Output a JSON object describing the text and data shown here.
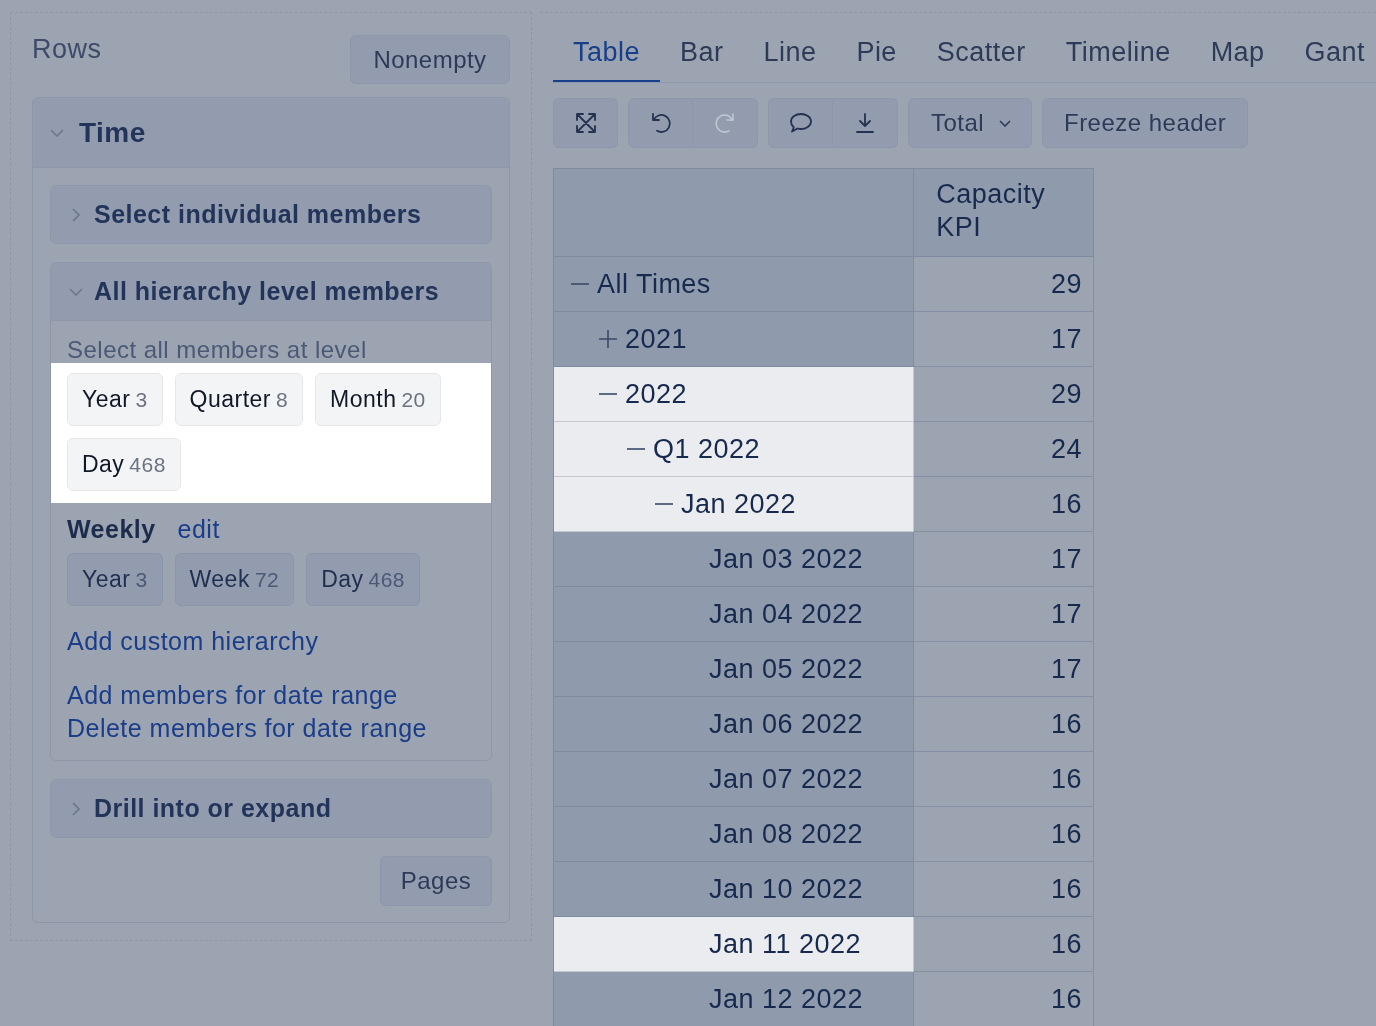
{
  "rows_panel": {
    "title": "Rows",
    "nonempty_button": "Nonempty",
    "dimension": {
      "title": "Time",
      "expanded": true,
      "sections": [
        {
          "title": "Select individual members",
          "expanded": false
        },
        {
          "title": "All hierarchy level members",
          "expanded": true,
          "hint": "Select all members at level",
          "level_group": {
            "highlighted": true,
            "levels": [
              {
                "label": "Year",
                "count": "3"
              },
              {
                "label": "Quarter",
                "count": "8"
              },
              {
                "label": "Month",
                "count": "20"
              },
              {
                "label": "Day",
                "count": "468"
              }
            ]
          },
          "hierarchies": [
            {
              "name": "Weekly",
              "edit_link": "edit",
              "levels": [
                {
                  "label": "Year",
                  "count": "3"
                },
                {
                  "label": "Week",
                  "count": "72"
                },
                {
                  "label": "Day",
                  "count": "468"
                }
              ]
            }
          ],
          "custom_hierarchy_link": "Add custom hierarchy",
          "date_range_links": [
            "Add members for date range",
            "Delete members for date range"
          ]
        },
        {
          "title": "Drill into or expand",
          "expanded": false
        }
      ],
      "pages_button": "Pages"
    }
  },
  "tabs": [
    {
      "label": "Table",
      "selected": true
    },
    {
      "label": "Bar",
      "selected": false
    },
    {
      "label": "Line",
      "selected": false
    },
    {
      "label": "Pie",
      "selected": false
    },
    {
      "label": "Scatter",
      "selected": false
    },
    {
      "label": "Timeline",
      "selected": false
    },
    {
      "label": "Map",
      "selected": false
    },
    {
      "label": "Gant",
      "selected": false
    }
  ],
  "toolbar": {
    "groups": [
      [
        {
          "kind": "fullscreen",
          "disabled": false
        }
      ],
      [
        {
          "kind": "undo",
          "disabled": false
        },
        {
          "kind": "redo",
          "disabled": true
        }
      ],
      [
        {
          "kind": "comment",
          "disabled": false
        },
        {
          "kind": "download",
          "disabled": false
        }
      ]
    ],
    "total_dropdown": "Total",
    "freeze_button": "Freeze header"
  },
  "table": {
    "columns": [
      {
        "label": "Capacity KPI"
      }
    ],
    "rows": [
      {
        "label": "All Times",
        "value": "29",
        "expanded": true,
        "highlighted": false,
        "children": [
          {
            "label": "2021",
            "value": "17",
            "expanded": false,
            "highlighted": false
          },
          {
            "label": "2022",
            "value": "29",
            "expanded": true,
            "highlighted": true,
            "children": [
              {
                "label": "Q1 2022",
                "value": "24",
                "expanded": true,
                "highlighted": true,
                "children": [
                  {
                    "label": "Jan 2022",
                    "value": "16",
                    "expanded": true,
                    "highlighted": true,
                    "children": [
                      {
                        "label": "Jan 03 2022",
                        "value": "17",
                        "highlighted": false
                      },
                      {
                        "label": "Jan 04 2022",
                        "value": "17",
                        "highlighted": false
                      },
                      {
                        "label": "Jan 05 2022",
                        "value": "17",
                        "highlighted": false
                      },
                      {
                        "label": "Jan 06 2022",
                        "value": "16",
                        "highlighted": false
                      },
                      {
                        "label": "Jan 07 2022",
                        "value": "16",
                        "highlighted": false
                      },
                      {
                        "label": "Jan 08 2022",
                        "value": "16",
                        "highlighted": false
                      },
                      {
                        "label": "Jan 10 2022",
                        "value": "16",
                        "highlighted": false
                      },
                      {
                        "label": "Jan 11 2022",
                        "value": "16",
                        "highlighted": true
                      },
                      {
                        "label": "Jan 12 2022",
                        "value": "16",
                        "highlighted": false
                      }
                    ]
                  }
                ]
              }
            ]
          }
        ]
      }
    ]
  }
}
